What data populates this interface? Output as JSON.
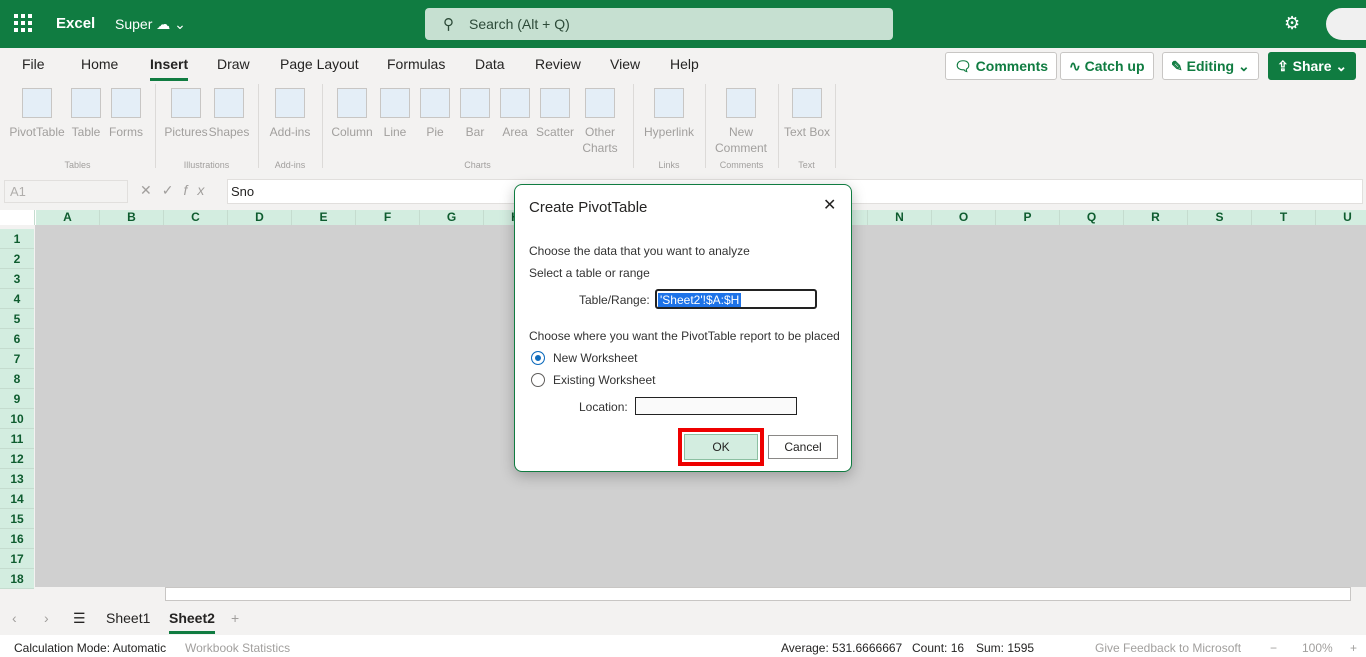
{
  "header": {
    "app": "Excel",
    "doc": "Super",
    "search_placeholder": "Search (Alt + Q)"
  },
  "tabs": [
    "File",
    "Home",
    "Insert",
    "Draw",
    "Page Layout",
    "Formulas",
    "Data",
    "Review",
    "View",
    "Help"
  ],
  "active_tab": "Insert",
  "right_buttons": {
    "comments": "Comments",
    "catchup": "Catch up",
    "editing": "Editing",
    "share": "Share"
  },
  "ribbon": {
    "buttons": [
      "PivotTable",
      "Table",
      "Forms",
      "Pictures",
      "Shapes",
      "Add-ins",
      "Column",
      "Line",
      "Pie",
      "Bar",
      "Area",
      "Scatter",
      "Other Charts",
      "Hyperlink",
      "New Comment",
      "Text Box"
    ],
    "groups": [
      "Tables",
      "Illustrations",
      "Add-ins",
      "Charts",
      "Links",
      "Comments",
      "Text"
    ]
  },
  "formula_bar": {
    "name_box": "A1",
    "fx": "fx",
    "value": "Sno"
  },
  "columns": [
    "A",
    "B",
    "C",
    "D",
    "E",
    "F",
    "G",
    "H",
    "I",
    "J",
    "K",
    "L",
    "M",
    "N",
    "O",
    "P",
    "Q",
    "R",
    "S",
    "T",
    "U"
  ],
  "rows": [
    "1",
    "2",
    "3",
    "4",
    "5",
    "6",
    "7",
    "8",
    "9",
    "10",
    "11",
    "12",
    "13",
    "14",
    "15",
    "16",
    "17",
    "18"
  ],
  "sheets": [
    "Sheet1",
    "Sheet2"
  ],
  "active_sheet": "Sheet2",
  "status": {
    "calc": "Calculation Mode: Automatic",
    "stats": "Workbook Statistics",
    "average": "Average: 531.6666667",
    "count": "Count: 16",
    "sum": "Sum: 1595",
    "feedback": "Give Feedback to Microsoft",
    "zoom": "100%"
  },
  "dialog": {
    "title": "Create PivotTable",
    "choose_data": "Choose the data that you want to analyze",
    "select_range": "Select a table or range",
    "range_label": "Table/Range:",
    "range_value": "'Sheet2'!$A:$H",
    "choose_place": "Choose where you want the PivotTable report to be placed",
    "new_ws": "New Worksheet",
    "existing_ws": "Existing Worksheet",
    "location_label": "Location:",
    "ok": "OK",
    "cancel": "Cancel",
    "selected_option": "New Worksheet"
  },
  "colors": {
    "brand": "#107c41",
    "highlight": "#e00000"
  }
}
